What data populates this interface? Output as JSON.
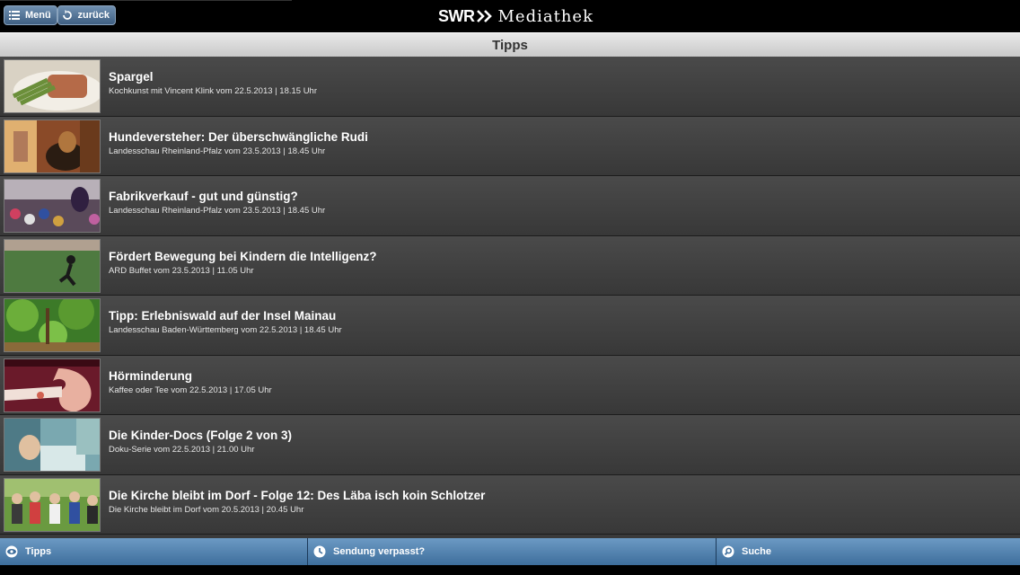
{
  "header": {
    "menu_label": "Menü",
    "back_label": "zurück",
    "brand_swr": "SWR",
    "brand_name": "Mediathek"
  },
  "section": {
    "title": "Tipps"
  },
  "items": [
    {
      "title": "Spargel",
      "subtitle": "Kochkunst mit Vincent Klink vom 22.5.2013 | 18.15 Uhr"
    },
    {
      "title": "Hundeversteher: Der überschwängliche Rudi",
      "subtitle": "Landesschau Rheinland-Pfalz vom 23.5.2013 | 18.45 Uhr"
    },
    {
      "title": "Fabrikverkauf - gut und günstig?",
      "subtitle": "Landesschau Rheinland-Pfalz vom 23.5.2013 | 18.45 Uhr"
    },
    {
      "title": "Fördert Bewegung bei Kindern die Intelligenz?",
      "subtitle": "ARD Buffet vom 23.5.2013 | 11.05 Uhr"
    },
    {
      "title": "Tipp: Erlebniswald auf der Insel Mainau",
      "subtitle": "Landesschau Baden-Württemberg vom 22.5.2013 | 18.45 Uhr"
    },
    {
      "title": "Hörminderung",
      "subtitle": "Kaffee oder Tee vom 22.5.2013 | 17.05 Uhr"
    },
    {
      "title": "Die Kinder-Docs (Folge 2 von 3)",
      "subtitle": "Doku-Serie vom 22.5.2013 | 21.00 Uhr"
    },
    {
      "title": "Die Kirche bleibt im Dorf - Folge 12: Des Läba isch koin Schlotzer",
      "subtitle": "Die Kirche bleibt im Dorf vom 20.5.2013 | 20.45 Uhr"
    }
  ],
  "tabs": {
    "tipps": "Tipps",
    "missed": "Sendung verpasst?",
    "search": "Suche"
  },
  "colors": {
    "tab_blue": "#4f80ae",
    "row_dark": "#3f3f3f",
    "header_gray": "#d6d6d6"
  }
}
